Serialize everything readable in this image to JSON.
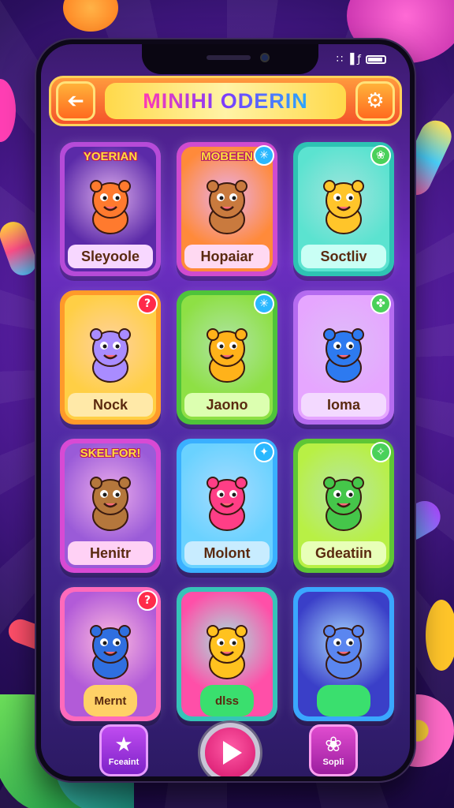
{
  "status_bar": {
    "glyphs": "∷ ▐ ƒ"
  },
  "header": {
    "title": "MINIHI ODERIN",
    "back_glyph": "➔",
    "settings_glyph": "⚙"
  },
  "cards": [
    {
      "top_label": "YOERIAN",
      "label": "Sleyoole",
      "badge": "",
      "colors": {
        "frame": "#b64bd8",
        "bg": "#5b2aa8",
        "label_bg": "#f7d7ff",
        "creature": "#ff7a2e"
      }
    },
    {
      "top_label": "MOBEEN",
      "label": "Hopaiar",
      "badge": "✳",
      "colors": {
        "frame": "#d04bcf",
        "bg": "#ff8a3a",
        "label_bg": "#ffd9f2",
        "creature": "#c97a3e"
      }
    },
    {
      "top_label": "",
      "label": "Soctliv",
      "badge": "❀",
      "colors": {
        "frame": "#2ec3b3",
        "bg": "#5be3d0",
        "label_bg": "#c9fff5",
        "creature": "#ffc52a"
      }
    },
    {
      "top_label": "",
      "label": "Nock",
      "badge": "?",
      "colors": {
        "frame": "#ff9a2a",
        "bg": "#ffcf45",
        "label_bg": "#ffe9a8",
        "creature": "#a98cff"
      }
    },
    {
      "top_label": "",
      "label": "Jaono",
      "badge": "✳",
      "colors": {
        "frame": "#4fc33a",
        "bg": "#8ee045",
        "label_bg": "#dcffb0",
        "creature": "#ffb21a"
      }
    },
    {
      "top_label": "",
      "label": "Ioma",
      "badge": "✤",
      "colors": {
        "frame": "#b56bf0",
        "bg": "#e6a6ff",
        "label_bg": "#f3d9ff",
        "creature": "#2d7af0"
      }
    },
    {
      "top_label": "SKELFOR!",
      "label": "Henitr",
      "badge": "",
      "colors": {
        "frame": "#d84ad4",
        "bg": "#9a5bd8",
        "label_bg": "#ffd1f5",
        "creature": "#b5773c"
      }
    },
    {
      "top_label": "",
      "label": "Molont",
      "badge": "✦",
      "colors": {
        "frame": "#3ab0ff",
        "bg": "#6ad2ff",
        "label_bg": "#c8ecff",
        "creature": "#ff3e86"
      }
    },
    {
      "top_label": "",
      "label": "Gdeatiin",
      "badge": "✧",
      "colors": {
        "frame": "#5ec635",
        "bg": "#b8f045",
        "label_bg": "#e8ffb8",
        "creature": "#45c64a"
      }
    },
    {
      "top_label": "",
      "label": "Mernt",
      "badge": "?",
      "colors": {
        "frame": "#ff6abb",
        "bg": "#b25bd8",
        "label_bg": "#ffd166",
        "creature": "#2f6fe0"
      }
    },
    {
      "top_label": "",
      "label": "dlss",
      "badge": "",
      "colors": {
        "frame": "#36c4b8",
        "bg": "#ff4fa8",
        "label_bg": "#3adf6e",
        "creature": "#ffc21f"
      }
    },
    {
      "top_label": "",
      "label": "",
      "badge": "",
      "colors": {
        "frame": "#3aa7ff",
        "bg": "#3a3fc8",
        "label_bg": "#3adf6e",
        "creature": "#5a86f0"
      }
    }
  ],
  "bottom_nav": {
    "left_label": "Fceaint",
    "left_glyph": "★",
    "right_label": "Sopli",
    "right_glyph": "❀"
  },
  "colors": {
    "header_gradient_top": "#ff9a3d",
    "header_gradient_bottom": "#f4532a",
    "play_button": "#d4126a",
    "background": "#5b1fa8"
  }
}
